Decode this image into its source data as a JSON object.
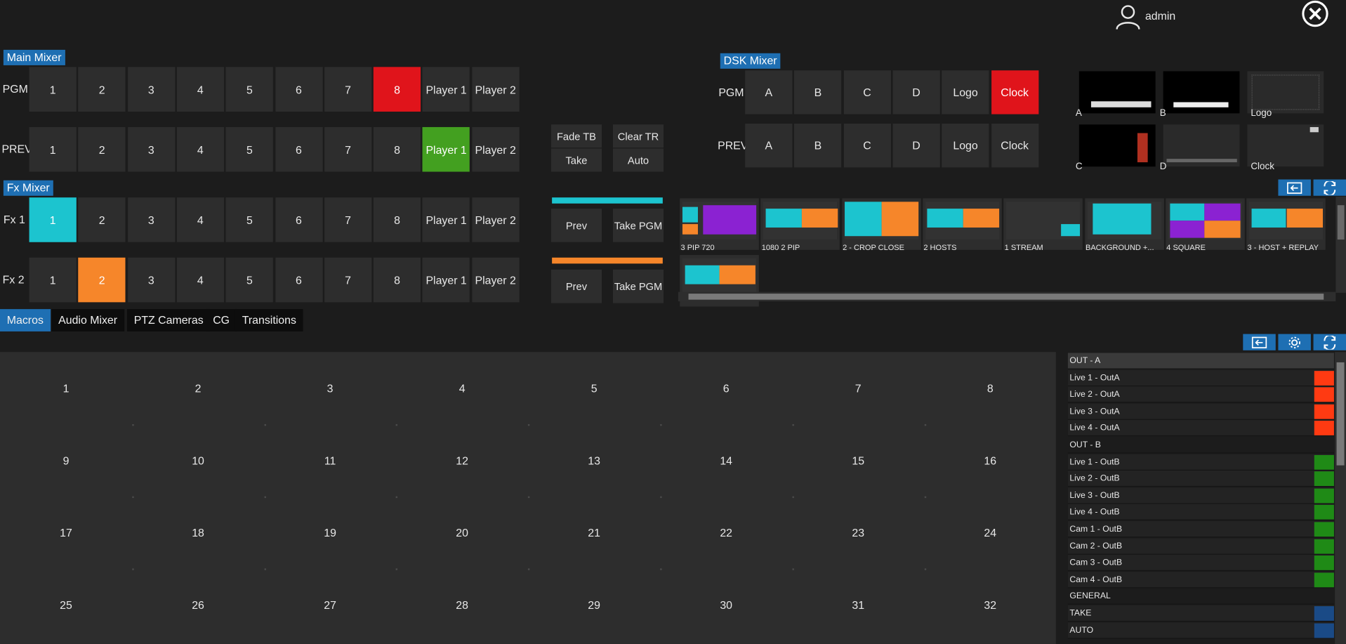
{
  "header": {
    "user": "admin"
  },
  "main_mixer": {
    "title": "Main Mixer",
    "pgm_label": "PGM",
    "prev_label": "PREV",
    "sources": [
      "1",
      "2",
      "3",
      "4",
      "5",
      "6",
      "7",
      "8",
      "Player 1",
      "Player 2"
    ],
    "pgm_active": "8",
    "prev_active": "Player 1"
  },
  "fx_mixer": {
    "title": "Fx Mixer",
    "fx1_label": "Fx 1",
    "fx2_label": "Fx 2",
    "sources": [
      "1",
      "2",
      "3",
      "4",
      "5",
      "6",
      "7",
      "8",
      "Player 1",
      "Player 2"
    ],
    "fx1_active": "1",
    "fx2_active": "2"
  },
  "transition": {
    "fade_tb": "Fade TB",
    "clear_tr": "Clear TR",
    "take": "Take",
    "auto": "Auto",
    "fx1_prev": "Prev",
    "fx1_take_pgm": "Take PGM",
    "fx2_prev": "Prev",
    "fx2_take_pgm": "Take PGM"
  },
  "dsk_mixer": {
    "title": "DSK Mixer",
    "pgm_label": "PGM",
    "prev_label": "PREV",
    "sources": [
      "A",
      "B",
      "C",
      "D",
      "Logo",
      "Clock"
    ],
    "pgm_active": "Clock",
    "previews": [
      "A",
      "B",
      "Logo",
      "C",
      "D",
      "Clock"
    ]
  },
  "layouts": [
    "3 PIP 720",
    "1080 2 PIP",
    "2 - CROP CLOSE",
    "2 HOSTS",
    "1 STREAM",
    "BACKGROUND +...",
    "4 SQUARE",
    "3 - HOST + REPLAY",
    ""
  ],
  "tabs": [
    "Macros",
    "Audio Mixer",
    "PTZ Cameras",
    "CG",
    "Transitions"
  ],
  "macros": [
    "1",
    "2",
    "3",
    "4",
    "5",
    "6",
    "7",
    "8",
    "9",
    "10",
    "11",
    "12",
    "13",
    "14",
    "15",
    "16",
    "17",
    "18",
    "19",
    "20",
    "21",
    "22",
    "23",
    "24",
    "25",
    "26",
    "27",
    "28",
    "29",
    "30",
    "31",
    "32"
  ],
  "outputs": [
    {
      "label": "OUT - A",
      "type": "header"
    },
    {
      "label": "Live 1 - OutA",
      "color": "#ff3a12"
    },
    {
      "label": "Live 2 - OutA",
      "color": "#ff3a12"
    },
    {
      "label": "Live 3 - OutA",
      "color": "#ff3a12"
    },
    {
      "label": "Live 4 - OutA",
      "color": "#ff3a12"
    },
    {
      "label": "OUT - B",
      "type": "header"
    },
    {
      "label": "Live 1 - OutB",
      "color": "#1f8a16"
    },
    {
      "label": "Live 2 - OutB",
      "color": "#1f8a16"
    },
    {
      "label": "Live 3 - OutB",
      "color": "#1f8a16"
    },
    {
      "label": "Live 4 - OutB",
      "color": "#1f8a16"
    },
    {
      "label": "Cam 1 - OutB",
      "color": "#1f8a16"
    },
    {
      "label": "Cam 2 - OutB",
      "color": "#1f8a16"
    },
    {
      "label": "Cam 3 - OutB",
      "color": "#1f8a16"
    },
    {
      "label": "Cam 4 - OutB",
      "color": "#1f8a16"
    },
    {
      "label": "GENERAL",
      "type": "header"
    },
    {
      "label": "TAKE",
      "color": "#1a4a86"
    },
    {
      "label": "AUTO",
      "color": "#1a4a86"
    }
  ],
  "colors": {
    "accent": "#1e6fb3",
    "cyan": "#1cc4cf",
    "orange": "#f6862a",
    "purple": "#8b22d2",
    "pgm": "#e0141b",
    "prev": "#43a020"
  }
}
